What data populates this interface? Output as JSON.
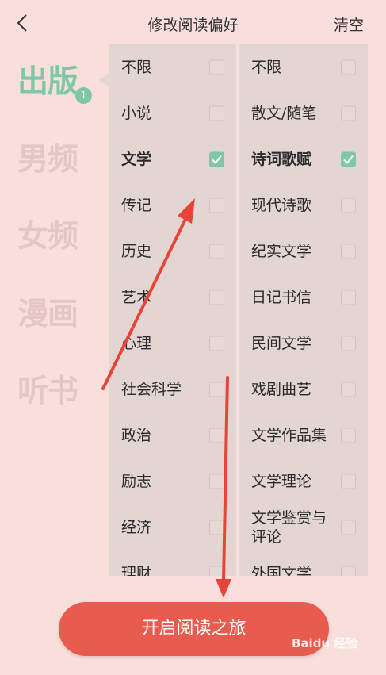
{
  "header": {
    "back_icon": "chevron-left-icon",
    "title": "修改阅读偏好",
    "clear_label": "清空"
  },
  "categories": [
    {
      "label": "出版",
      "active": true,
      "badge": "1"
    },
    {
      "label": "男频",
      "active": false
    },
    {
      "label": "女频",
      "active": false
    },
    {
      "label": "漫画",
      "active": false
    },
    {
      "label": "听书",
      "active": false
    }
  ],
  "left_column": [
    {
      "label": "不限",
      "checked": false
    },
    {
      "label": "小说",
      "checked": false
    },
    {
      "label": "文学",
      "checked": true
    },
    {
      "label": "传记",
      "checked": false
    },
    {
      "label": "历史",
      "checked": false
    },
    {
      "label": "艺术",
      "checked": false
    },
    {
      "label": "心理",
      "checked": false
    },
    {
      "label": "社会科学",
      "checked": false
    },
    {
      "label": "政治",
      "checked": false
    },
    {
      "label": "励志",
      "checked": false
    },
    {
      "label": "经济",
      "checked": false
    },
    {
      "label": "理财",
      "checked": false
    }
  ],
  "right_column": [
    {
      "label": "不限",
      "checked": false
    },
    {
      "label": "散文/随笔",
      "checked": false
    },
    {
      "label": "诗词歌赋",
      "checked": true
    },
    {
      "label": "现代诗歌",
      "checked": false
    },
    {
      "label": "纪实文学",
      "checked": false
    },
    {
      "label": "日记书信",
      "checked": false
    },
    {
      "label": "民间文学",
      "checked": false
    },
    {
      "label": "戏剧曲艺",
      "checked": false
    },
    {
      "label": "文学作品集",
      "checked": false
    },
    {
      "label": "文学理论",
      "checked": false
    },
    {
      "label": "文学鉴赏与评论",
      "checked": false
    },
    {
      "label": "外国文学",
      "checked": false
    }
  ],
  "start_button": {
    "label": "开启阅读之旅"
  },
  "watermark": {
    "text": "Baidu 经验"
  },
  "colors": {
    "accent_green": "#7fc7a6",
    "button_red": "#e85c50",
    "annotation_arrow": "#e8453a",
    "background": "#f9dfdb"
  }
}
